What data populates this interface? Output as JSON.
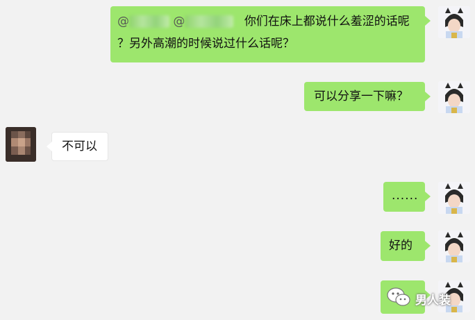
{
  "messages": [
    {
      "side": "right",
      "mention1": "@",
      "mention2": "@",
      "text_line1": "你们在床上都说什么羞涩的话呢",
      "text_line2": "？另外高潮的时候说过什么话呢？"
    },
    {
      "side": "right",
      "text": "可以分享一下嘛？"
    },
    {
      "side": "left",
      "text": "不可以"
    },
    {
      "side": "right",
      "text": "......"
    },
    {
      "side": "right",
      "text": "好的"
    },
    {
      "side": "right",
      "text": ""
    }
  ],
  "watermark": {
    "text": "男人装",
    "icon": "wechat-icon"
  },
  "colors": {
    "background": "#f2f2f2",
    "my_bubble": "#9de66d",
    "their_bubble": "#ffffff"
  }
}
